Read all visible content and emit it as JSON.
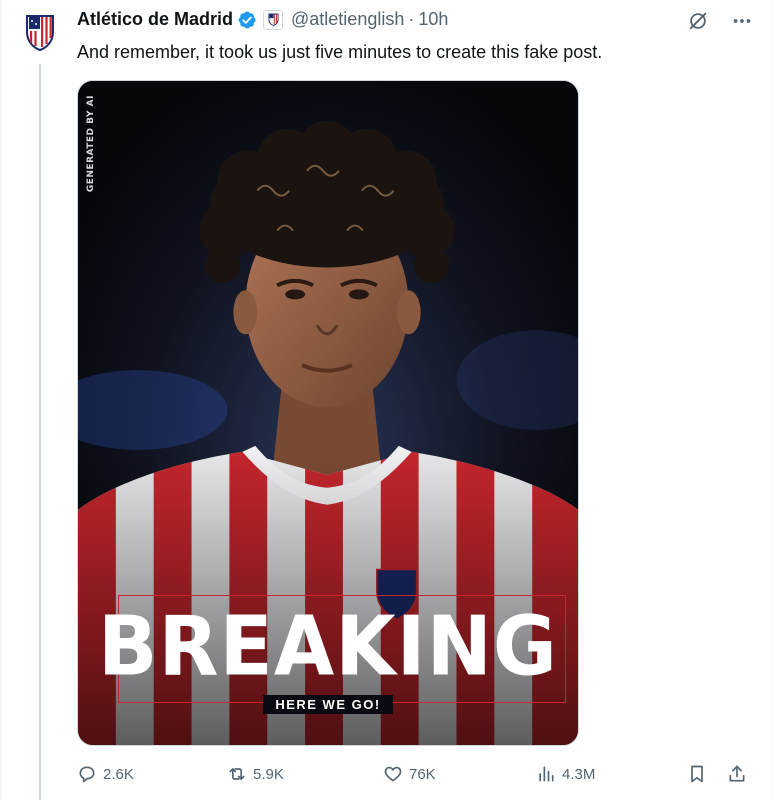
{
  "account": {
    "name": "Atlético de Madrid",
    "handle": "@atletienglish",
    "separator": "·",
    "time": "10h"
  },
  "tweet": {
    "text": "And remember, it took us just five minutes to create this fake post."
  },
  "media": {
    "side_label": "GENERATED BY AI",
    "headline": "BREAKING",
    "subline": "HERE WE GO!"
  },
  "actions": {
    "replies": "2.6K",
    "reposts": "5.9K",
    "likes": "76K",
    "views": "4.3M"
  },
  "colors": {
    "atletico_red": "#c6262d",
    "verified_blue": "#1d9bf0",
    "muted_text": "#536471"
  },
  "icons": [
    "club-crest-icon",
    "verified-badge-icon",
    "affiliate-badge-icon",
    "grok-icon",
    "more-icon",
    "reply-icon",
    "repost-icon",
    "like-icon",
    "views-icon",
    "bookmark-icon",
    "share-icon"
  ]
}
